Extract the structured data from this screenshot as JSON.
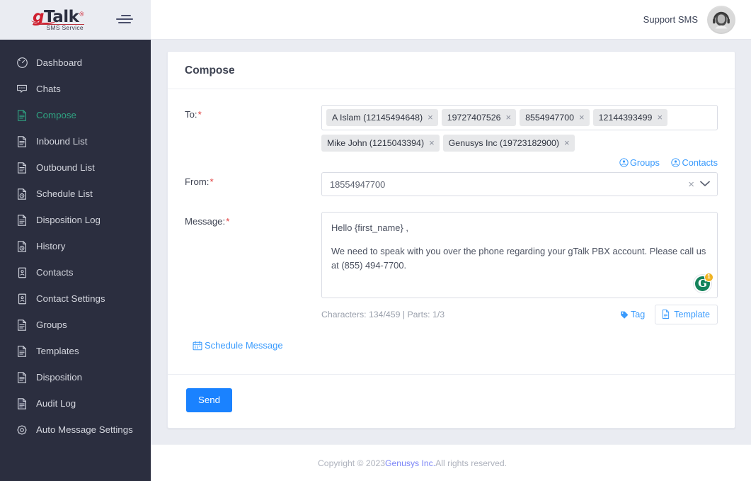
{
  "brand": {
    "logo_main_g": "g",
    "logo_main_rest": "Talk",
    "logo_registered": "®",
    "logo_sub": "SMS Service",
    "menu_icon": "hamburger-icon"
  },
  "topbar": {
    "support_label": "Support SMS",
    "avatar_icon": "support-agent-avatar"
  },
  "sidebar": {
    "active": "Compose",
    "items": [
      {
        "label": "Dashboard",
        "icon": "dashboard-icon"
      },
      {
        "label": "Chats",
        "icon": "chat-icon"
      },
      {
        "label": "Compose",
        "icon": "compose-document-icon"
      },
      {
        "label": "Inbound List",
        "icon": "document-list-icon"
      },
      {
        "label": "Outbound List",
        "icon": "document-list-icon"
      },
      {
        "label": "Schedule List",
        "icon": "document-clock-icon"
      },
      {
        "label": "Disposition Log",
        "icon": "document-list-icon"
      },
      {
        "label": "History",
        "icon": "document-clock-icon"
      },
      {
        "label": "Contacts",
        "icon": "contact-card-icon"
      },
      {
        "label": "Contact Settings",
        "icon": "contact-card-icon"
      },
      {
        "label": "Groups",
        "icon": "document-list-icon"
      },
      {
        "label": "Templates",
        "icon": "document-list-icon"
      },
      {
        "label": "Disposition",
        "icon": "document-list-icon"
      },
      {
        "label": "Audit Log",
        "icon": "document-page-icon"
      },
      {
        "label": "Auto Message Settings",
        "icon": "gear-icon"
      }
    ]
  },
  "compose": {
    "title": "Compose",
    "to": {
      "label": "To:",
      "required_mark": "*",
      "chips_row1": [
        "A Islam (12145494648)",
        "19727407526",
        "8554947700",
        "12144393499"
      ],
      "chips_row2": [
        "Mike John (1215043394)",
        "Genusys Inc (19723182900)"
      ],
      "remove_glyph": "×",
      "groups_link": "Groups",
      "contacts_link": "Contacts"
    },
    "from": {
      "label": "From:",
      "required_mark": "*",
      "value": "18554947700",
      "clear_glyph": "×",
      "caret_glyph": "⌵"
    },
    "message": {
      "label": "Message:",
      "required_mark": "*",
      "line1": "Hello {first_name} ,",
      "line2": "We need to speak with you over the phone regarding your gTalk PBX account. Please call us at (855) 494-7700.",
      "grammarly_letter": "G",
      "grammarly_badge": "1"
    },
    "char_count": "Characters: 134/459 | Parts: 1/3",
    "tag_label": "Tag",
    "template_label": "Template",
    "schedule_label": "Schedule Message",
    "send_label": "Send"
  },
  "footer": {
    "prefix": "Copyright © 2023 ",
    "company": "Genusys Inc.",
    "suffix": " All rights reserved."
  },
  "colors": {
    "sidebar_bg": "#2b2e3f",
    "active_green": "#2fa583",
    "link_blue": "#3a9bfd",
    "send_blue": "#1a82ff",
    "required_red": "#e03b3b",
    "logo_red": "#cf2030",
    "content_bg": "#eaecf2",
    "grammarly_green": "#15835b",
    "grammarly_badge": "#f0b323"
  }
}
